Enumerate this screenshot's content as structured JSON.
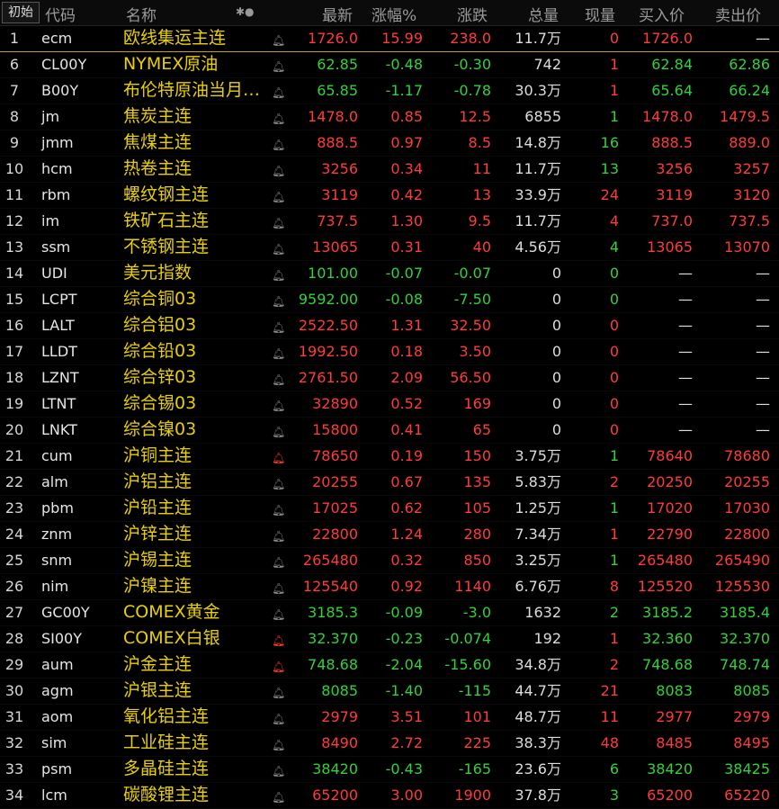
{
  "header": {
    "badge": "初始",
    "code": "代码",
    "name": "名称",
    "sort_icon": "✱●",
    "last": "最新",
    "pct": "涨幅%",
    "chg": "涨跌",
    "vol": "总量",
    "cur": "现量",
    "bid": "买入价",
    "ask": "卖出价"
  },
  "colors": {
    "up": "#ff3b3b",
    "down": "#33d13a",
    "name": "#e9d000",
    "alert": "#ff3b1f"
  },
  "rows": [
    {
      "idx": "1",
      "code": "ecm",
      "name": "欧线集运主连",
      "alert": false,
      "last": "1726.0",
      "pct": "15.99",
      "chg": "238.0",
      "vol": "11.7万",
      "cur": "0",
      "bid": "1726.0",
      "ask": "—",
      "dir": "red",
      "curdir": "red",
      "bidc": "red",
      "askc": "white"
    },
    {
      "idx": "6",
      "code": "CL00Y",
      "name": "NYMEX原油",
      "alert": false,
      "last": "62.85",
      "pct": "-0.48",
      "chg": "-0.30",
      "vol": "742",
      "cur": "1",
      "bid": "62.84",
      "ask": "62.86",
      "dir": "green",
      "curdir": "red",
      "bidc": "green",
      "askc": "green"
    },
    {
      "idx": "7",
      "code": "B00Y",
      "name": "布伦特原油当月…",
      "alert": false,
      "last": "65.85",
      "pct": "-1.17",
      "chg": "-0.78",
      "vol": "30.3万",
      "cur": "1",
      "bid": "65.64",
      "ask": "66.24",
      "dir": "green",
      "curdir": "red",
      "bidc": "green",
      "askc": "green"
    },
    {
      "idx": "8",
      "code": "jm",
      "name": "焦炭主连",
      "alert": false,
      "last": "1478.0",
      "pct": "0.85",
      "chg": "12.5",
      "vol": "6855",
      "cur": "1",
      "bid": "1478.0",
      "ask": "1479.5",
      "dir": "red",
      "curdir": "green",
      "bidc": "red",
      "askc": "red"
    },
    {
      "idx": "9",
      "code": "jmm",
      "name": "焦煤主连",
      "alert": false,
      "last": "888.5",
      "pct": "0.97",
      "chg": "8.5",
      "vol": "14.8万",
      "cur": "16",
      "bid": "888.5",
      "ask": "889.0",
      "dir": "red",
      "curdir": "green",
      "bidc": "red",
      "askc": "red"
    },
    {
      "idx": "10",
      "code": "hcm",
      "name": "热卷主连",
      "alert": false,
      "last": "3256",
      "pct": "0.34",
      "chg": "11",
      "vol": "11.7万",
      "cur": "13",
      "bid": "3256",
      "ask": "3257",
      "dir": "red",
      "curdir": "green",
      "bidc": "red",
      "askc": "red"
    },
    {
      "idx": "11",
      "code": "rbm",
      "name": "螺纹钢主连",
      "alert": false,
      "last": "3119",
      "pct": "0.42",
      "chg": "13",
      "vol": "33.9万",
      "cur": "24",
      "bid": "3119",
      "ask": "3120",
      "dir": "red",
      "curdir": "red",
      "bidc": "red",
      "askc": "red"
    },
    {
      "idx": "12",
      "code": "im",
      "name": "铁矿石主连",
      "alert": false,
      "last": "737.5",
      "pct": "1.30",
      "chg": "9.5",
      "vol": "11.7万",
      "cur": "4",
      "bid": "737.0",
      "ask": "737.5",
      "dir": "red",
      "curdir": "red",
      "bidc": "red",
      "askc": "red"
    },
    {
      "idx": "13",
      "code": "ssm",
      "name": "不锈钢主连",
      "alert": false,
      "last": "13065",
      "pct": "0.31",
      "chg": "40",
      "vol": "4.56万",
      "cur": "4",
      "bid": "13065",
      "ask": "13070",
      "dir": "red",
      "curdir": "green",
      "bidc": "red",
      "askc": "red"
    },
    {
      "idx": "14",
      "code": "UDI",
      "name": "美元指数",
      "alert": false,
      "last": "101.00",
      "pct": "-0.07",
      "chg": "-0.07",
      "vol": "0",
      "cur": "0",
      "bid": "—",
      "ask": "—",
      "dir": "green",
      "curdir": "green",
      "bidc": "white",
      "askc": "white"
    },
    {
      "idx": "15",
      "code": "LCPT",
      "name": "综合铜03",
      "alert": false,
      "last": "9592.00",
      "pct": "-0.08",
      "chg": "-7.50",
      "vol": "0",
      "cur": "0",
      "bid": "—",
      "ask": "—",
      "dir": "green",
      "curdir": "green",
      "bidc": "white",
      "askc": "white"
    },
    {
      "idx": "16",
      "code": "LALT",
      "name": "综合铝03",
      "alert": false,
      "last": "2522.50",
      "pct": "1.31",
      "chg": "32.50",
      "vol": "0",
      "cur": "0",
      "bid": "—",
      "ask": "—",
      "dir": "red",
      "curdir": "red",
      "bidc": "white",
      "askc": "white"
    },
    {
      "idx": "17",
      "code": "LLDT",
      "name": "综合铅03",
      "alert": false,
      "last": "1992.50",
      "pct": "0.18",
      "chg": "3.50",
      "vol": "0",
      "cur": "0",
      "bid": "—",
      "ask": "—",
      "dir": "red",
      "curdir": "red",
      "bidc": "white",
      "askc": "white"
    },
    {
      "idx": "18",
      "code": "LZNT",
      "name": "综合锌03",
      "alert": false,
      "last": "2761.50",
      "pct": "2.09",
      "chg": "56.50",
      "vol": "0",
      "cur": "0",
      "bid": "—",
      "ask": "—",
      "dir": "red",
      "curdir": "red",
      "bidc": "white",
      "askc": "white"
    },
    {
      "idx": "19",
      "code": "LTNT",
      "name": "综合锡03",
      "alert": false,
      "last": "32890",
      "pct": "0.52",
      "chg": "169",
      "vol": "0",
      "cur": "0",
      "bid": "—",
      "ask": "—",
      "dir": "red",
      "curdir": "red",
      "bidc": "white",
      "askc": "white"
    },
    {
      "idx": "20",
      "code": "LNKT",
      "name": "综合镍03",
      "alert": false,
      "last": "15800",
      "pct": "0.41",
      "chg": "65",
      "vol": "0",
      "cur": "0",
      "bid": "—",
      "ask": "—",
      "dir": "red",
      "curdir": "red",
      "bidc": "white",
      "askc": "white"
    },
    {
      "idx": "21",
      "code": "cum",
      "name": "沪铜主连",
      "alert": true,
      "last": "78650",
      "pct": "0.19",
      "chg": "150",
      "vol": "3.75万",
      "cur": "1",
      "bid": "78640",
      "ask": "78680",
      "dir": "red",
      "curdir": "green",
      "bidc": "red",
      "askc": "red"
    },
    {
      "idx": "22",
      "code": "alm",
      "name": "沪铝主连",
      "alert": false,
      "last": "20255",
      "pct": "0.67",
      "chg": "135",
      "vol": "5.83万",
      "cur": "2",
      "bid": "20250",
      "ask": "20255",
      "dir": "red",
      "curdir": "red",
      "bidc": "red",
      "askc": "red"
    },
    {
      "idx": "23",
      "code": "pbm",
      "name": "沪铅主连",
      "alert": false,
      "last": "17025",
      "pct": "0.62",
      "chg": "105",
      "vol": "1.25万",
      "cur": "1",
      "bid": "17020",
      "ask": "17030",
      "dir": "red",
      "curdir": "green",
      "bidc": "red",
      "askc": "red"
    },
    {
      "idx": "24",
      "code": "znm",
      "name": "沪锌主连",
      "alert": false,
      "last": "22800",
      "pct": "1.24",
      "chg": "280",
      "vol": "7.34万",
      "cur": "1",
      "bid": "22790",
      "ask": "22800",
      "dir": "red",
      "curdir": "red",
      "bidc": "red",
      "askc": "red"
    },
    {
      "idx": "25",
      "code": "snm",
      "name": "沪锡主连",
      "alert": false,
      "last": "265480",
      "pct": "0.32",
      "chg": "850",
      "vol": "3.25万",
      "cur": "1",
      "bid": "265480",
      "ask": "265490",
      "dir": "red",
      "curdir": "green",
      "bidc": "red",
      "askc": "red"
    },
    {
      "idx": "26",
      "code": "nim",
      "name": "沪镍主连",
      "alert": false,
      "last": "125540",
      "pct": "0.92",
      "chg": "1140",
      "vol": "6.76万",
      "cur": "8",
      "bid": "125520",
      "ask": "125530",
      "dir": "red",
      "curdir": "red",
      "bidc": "red",
      "askc": "red"
    },
    {
      "idx": "27",
      "code": "GC00Y",
      "name": "COMEX黄金",
      "alert": false,
      "last": "3185.3",
      "pct": "-0.09",
      "chg": "-3.0",
      "vol": "1632",
      "cur": "2",
      "bid": "3185.2",
      "ask": "3185.4",
      "dir": "green",
      "curdir": "green",
      "bidc": "green",
      "askc": "green"
    },
    {
      "idx": "28",
      "code": "SI00Y",
      "name": "COMEX白银",
      "alert": true,
      "last": "32.370",
      "pct": "-0.23",
      "chg": "-0.074",
      "vol": "192",
      "cur": "1",
      "bid": "32.360",
      "ask": "32.370",
      "dir": "green",
      "curdir": "red",
      "bidc": "green",
      "askc": "green"
    },
    {
      "idx": "29",
      "code": "aum",
      "name": "沪金主连",
      "alert": true,
      "last": "748.68",
      "pct": "-2.04",
      "chg": "-15.60",
      "vol": "34.8万",
      "cur": "2",
      "bid": "748.68",
      "ask": "748.74",
      "dir": "green",
      "curdir": "red",
      "bidc": "green",
      "askc": "green"
    },
    {
      "idx": "30",
      "code": "agm",
      "name": "沪银主连",
      "alert": false,
      "last": "8085",
      "pct": "-1.40",
      "chg": "-115",
      "vol": "44.7万",
      "cur": "21",
      "bid": "8083",
      "ask": "8085",
      "dir": "green",
      "curdir": "red",
      "bidc": "green",
      "askc": "green"
    },
    {
      "idx": "31",
      "code": "aom",
      "name": "氧化铝主连",
      "alert": false,
      "last": "2979",
      "pct": "3.51",
      "chg": "101",
      "vol": "48.7万",
      "cur": "11",
      "bid": "2977",
      "ask": "2979",
      "dir": "red",
      "curdir": "red",
      "bidc": "red",
      "askc": "red"
    },
    {
      "idx": "32",
      "code": "sim",
      "name": "工业硅主连",
      "alert": false,
      "last": "8490",
      "pct": "2.72",
      "chg": "225",
      "vol": "38.3万",
      "cur": "48",
      "bid": "8485",
      "ask": "8495",
      "dir": "red",
      "curdir": "red",
      "bidc": "red",
      "askc": "red"
    },
    {
      "idx": "33",
      "code": "psm",
      "name": "多晶硅主连",
      "alert": false,
      "last": "38420",
      "pct": "-0.43",
      "chg": "-165",
      "vol": "23.6万",
      "cur": "6",
      "bid": "38420",
      "ask": "38425",
      "dir": "green",
      "curdir": "green",
      "bidc": "green",
      "askc": "green"
    },
    {
      "idx": "34",
      "code": "lcm",
      "name": "碳酸锂主连",
      "alert": false,
      "last": "65200",
      "pct": "3.00",
      "chg": "1900",
      "vol": "37.8万",
      "cur": "3",
      "bid": "65200",
      "ask": "65220",
      "dir": "red",
      "curdir": "green",
      "bidc": "red",
      "askc": "red"
    }
  ]
}
